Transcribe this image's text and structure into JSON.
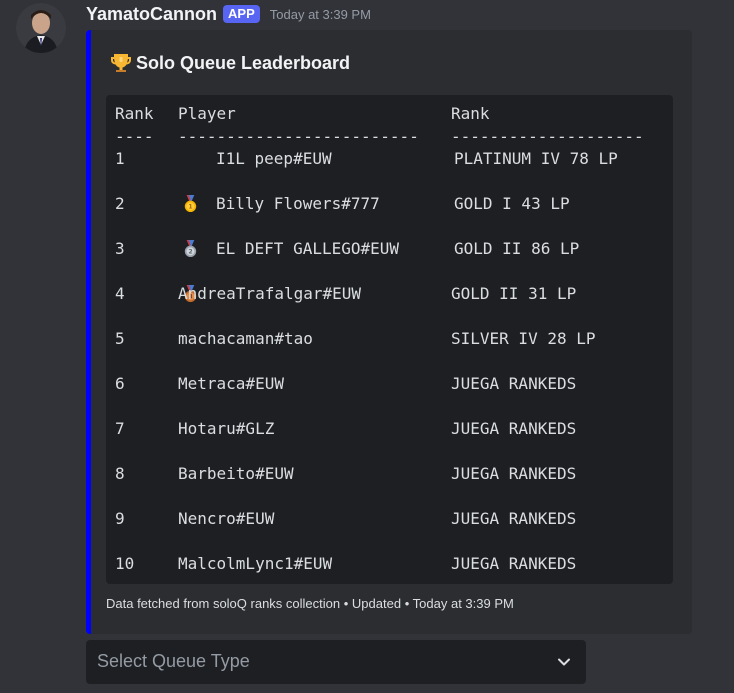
{
  "message": {
    "username": "YamatoCannon",
    "badge": "APP",
    "timestamp": "Today at 3:39 PM"
  },
  "embed": {
    "accent_color": "#0000ff",
    "title_icon": "trophy-icon",
    "title": "Solo Queue Leaderboard",
    "code": {
      "headers": {
        "rank": "Rank",
        "player": "Player",
        "tier": "Rank"
      },
      "separators": {
        "rank": "----",
        "player": "-------------------------",
        "tier": "--------------------"
      },
      "rows": [
        {
          "rank": "1",
          "medal": "gold-medal-icon",
          "player": "I1L peep#EUW",
          "tier": "PLATINUM IV 78 LP"
        },
        {
          "rank": "2",
          "medal": "silver-medal-icon",
          "player": "Billy Flowers#777",
          "tier": "GOLD I 43 LP"
        },
        {
          "rank": "3",
          "medal": "bronze-medal-icon",
          "player": "EL DEFT GALLEGO#EUW",
          "tier": "GOLD II 86 LP"
        },
        {
          "rank": "4",
          "player": "AndreaTrafalgar#EUW",
          "tier": "GOLD II 31 LP"
        },
        {
          "rank": "5",
          "player": "machacaman#tao",
          "tier": "SILVER IV 28 LP"
        },
        {
          "rank": "6",
          "player": "Metraca#EUW",
          "tier": "JUEGA RANKEDS"
        },
        {
          "rank": "7",
          "player": "Hotaru#GLZ",
          "tier": "JUEGA RANKEDS"
        },
        {
          "rank": "8",
          "player": "Barbeito#EUW",
          "tier": "JUEGA RANKEDS"
        },
        {
          "rank": "9",
          "player": "Nencro#EUW",
          "tier": "JUEGA RANKEDS"
        },
        {
          "rank": "10",
          "player": "MalcolmLync1#EUW",
          "tier": "JUEGA RANKEDS"
        }
      ]
    },
    "footer": {
      "source": "Data fetched from soloQ ranks collection",
      "dot": "•",
      "updated": "Updated",
      "dot2": "•",
      "time": "Today at 3:39 PM"
    }
  },
  "select_menu": {
    "placeholder": "Select Queue Type",
    "icon": "chevron-down-icon"
  }
}
